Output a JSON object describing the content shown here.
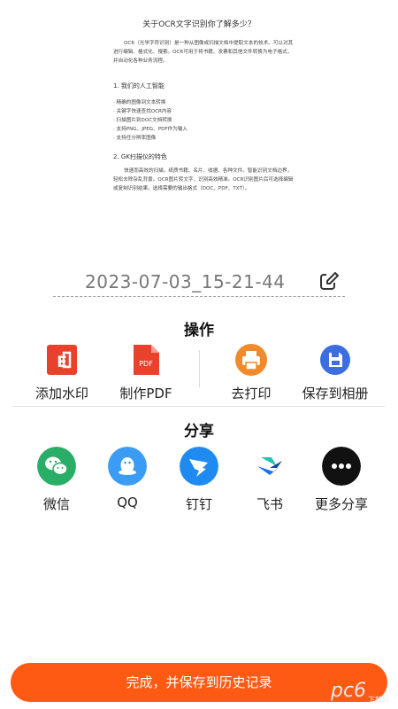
{
  "document": {
    "title": "关于OCR文字识别你了解多少？",
    "intro": "OCR（光学字符识别）是一种从图像或扫描文档中提取文本的技术。可以对其进行编辑、格式化、搜索。OCR可用于将书籍、发票和其他文件转换为电子格式，并自动化各种业务流程。",
    "section1_title": "1. 我们的人工智能",
    "section1_items": [
      "· 精确的图像到文本转换",
      "· 关键字快速查找OCR内容",
      "· 扫描图片到DOC文档转换",
      "· 支持PNG、JPEG、PDF作为输入",
      "· 支持任分辨率图像"
    ],
    "section2_title": "2. GK扫描仪的特色",
    "section2_text": "快速而高效的扫描。纸质书籍、名片、收据、各种文件。智能识别文档边界，轻松去除杂乱背景。OCR图片转文字，识别高效精准。OCR识别图片后可选择编辑或复制识别结果，选择需要的输出格式（DOC、PDF、TXT）。"
  },
  "filename": "2023-07-03_15-21-44",
  "operations": {
    "title": "操作",
    "items": [
      {
        "label": "添加水印",
        "icon": "watermark-icon",
        "color": "#e8412c"
      },
      {
        "label": "制作PDF",
        "icon": "pdf-icon",
        "color": "#e8412c"
      },
      {
        "label": "去打印",
        "icon": "printer-icon",
        "color": "#f08a2a"
      },
      {
        "label": "保存到相册",
        "icon": "save-icon",
        "color": "#3b6fe0"
      }
    ]
  },
  "share": {
    "title": "分享",
    "items": [
      {
        "label": "微信",
        "icon": "wechat-icon",
        "color": "#2aae67"
      },
      {
        "label": "QQ",
        "icon": "qq-icon",
        "color": "#3a9cf4"
      },
      {
        "label": "钉钉",
        "icon": "dingtalk-icon",
        "color": "#1f8af0"
      },
      {
        "label": "飞书",
        "icon": "feishu-icon",
        "color": "#1c6ff2"
      },
      {
        "label": "更多分享",
        "icon": "more-icon",
        "color": "#111111"
      }
    ]
  },
  "done_button": "完成，并保存到历史记录",
  "watermark_text": "pc6",
  "watermark_sub": "下载站",
  "colors": {
    "accent": "#ff5a14"
  }
}
